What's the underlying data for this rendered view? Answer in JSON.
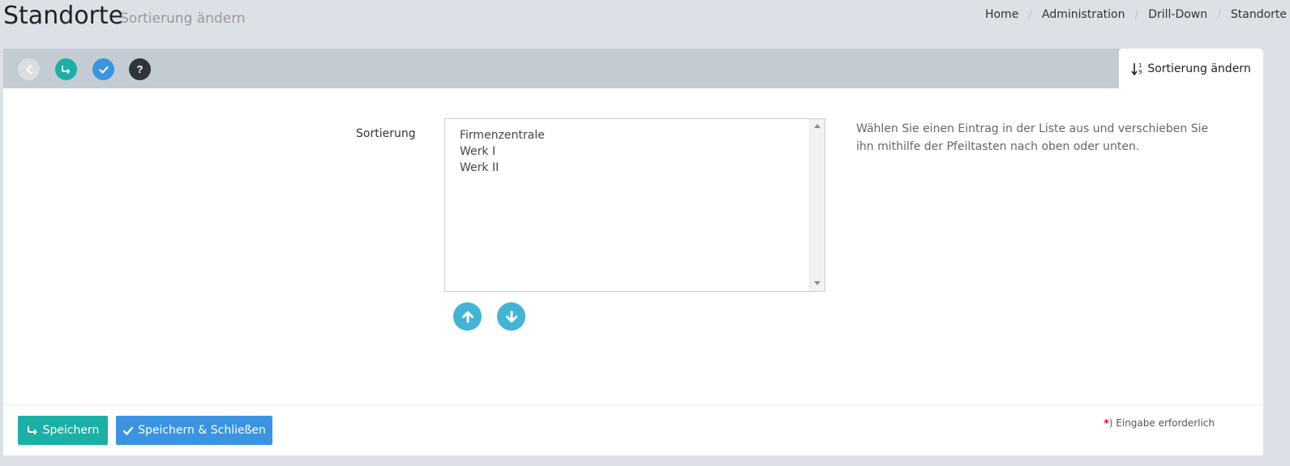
{
  "header": {
    "title": "Standorte",
    "subtitle": "Sortierung ändern",
    "breadcrumb": [
      "Home",
      "Administration",
      "Drill-Down",
      "Standorte"
    ]
  },
  "toolbar": {
    "buttons": [
      {
        "name": "back",
        "icon": "chevron-left-icon"
      },
      {
        "name": "save",
        "icon": "share-arrow-icon"
      },
      {
        "name": "save-close",
        "icon": "check-icon"
      },
      {
        "name": "help",
        "icon": "question-icon"
      }
    ],
    "help_glyph": "?",
    "tab_label": "Sortierung ändern",
    "tab_icon": "sort-numeric-icon"
  },
  "form": {
    "label": "Sortierung",
    "items": [
      "Firmenzentrale",
      "Werk I",
      "Werk II"
    ],
    "help_text": "Wählen Sie einen Eintrag in der Liste aus und verschieben Sie ihn mithilfe der Pfeiltasten nach oben oder unten."
  },
  "footer": {
    "save_label": "Speichern",
    "save_close_label": "Speichern & Schließen",
    "required_star": "*",
    "required_text": ") Eingabe erforderlich"
  },
  "colors": {
    "teal": "#1bb0a5",
    "blue": "#3a94e0",
    "arrow": "#42b4d6",
    "dark": "#2f353b",
    "toolbar": "#c2ccd2",
    "background": "#dce1e8"
  }
}
